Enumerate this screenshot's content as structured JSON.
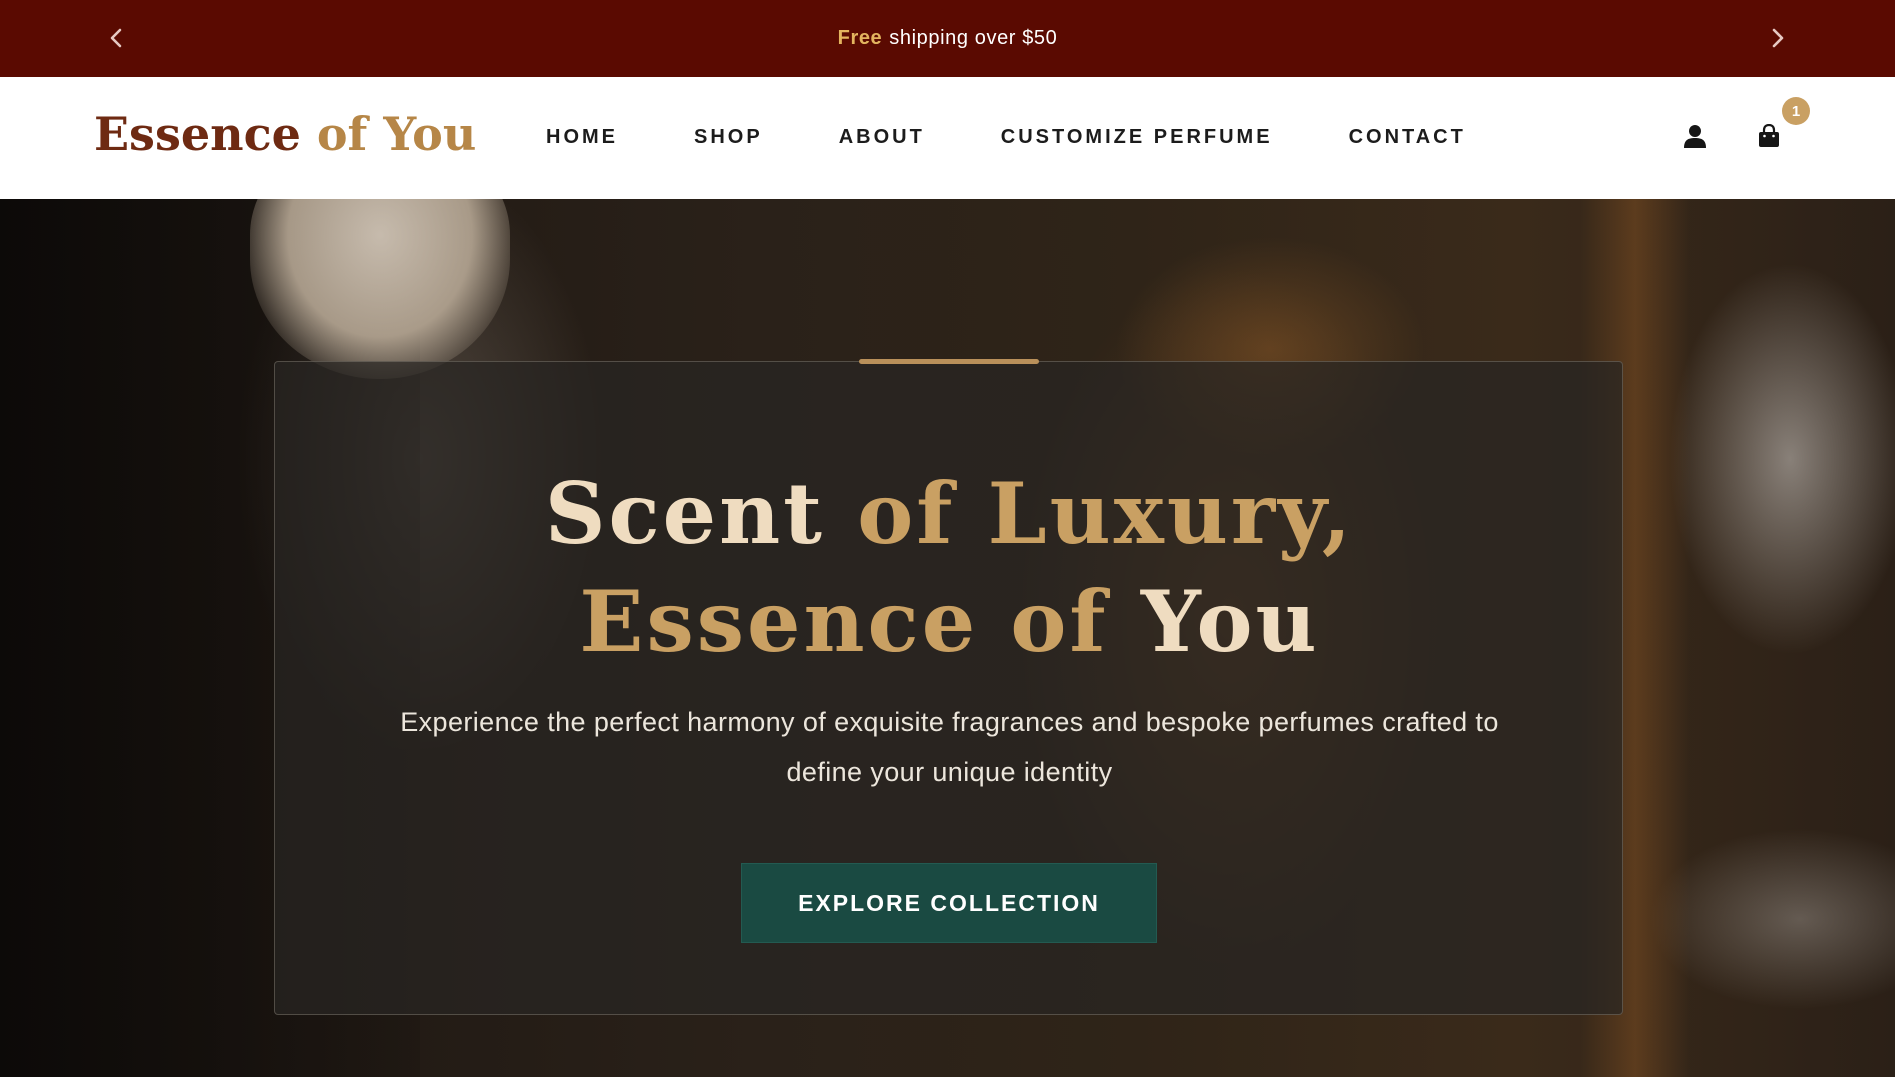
{
  "announcement": {
    "highlight": "Free",
    "text": "shipping over $50",
    "prev_icon": "chevron-left-icon",
    "next_icon": "chevron-right-icon",
    "background_color": "#5a0a01",
    "highlight_color": "#e3b45f"
  },
  "header": {
    "logo": {
      "part1": "Essence",
      "part2": "of You"
    },
    "nav": [
      "HOME",
      "SHOP",
      "ABOUT",
      "CUSTOMIZE PERFUME",
      "CONTACT"
    ],
    "icons": {
      "account": "user-icon",
      "cart": "shopping-bag-icon"
    },
    "cart_count": "1"
  },
  "hero": {
    "title_line1": [
      "Scent",
      "of",
      "Luxury,"
    ],
    "title_line2": [
      "Essence",
      "of",
      "You"
    ],
    "subtitle": "Experience the perfect harmony of exquisite fragrances and bespoke perfumes crafted to define your unique identity",
    "cta": "EXPLORE COLLECTION",
    "accent_color": "#c9a063",
    "cta_color": "#1a4a42"
  }
}
